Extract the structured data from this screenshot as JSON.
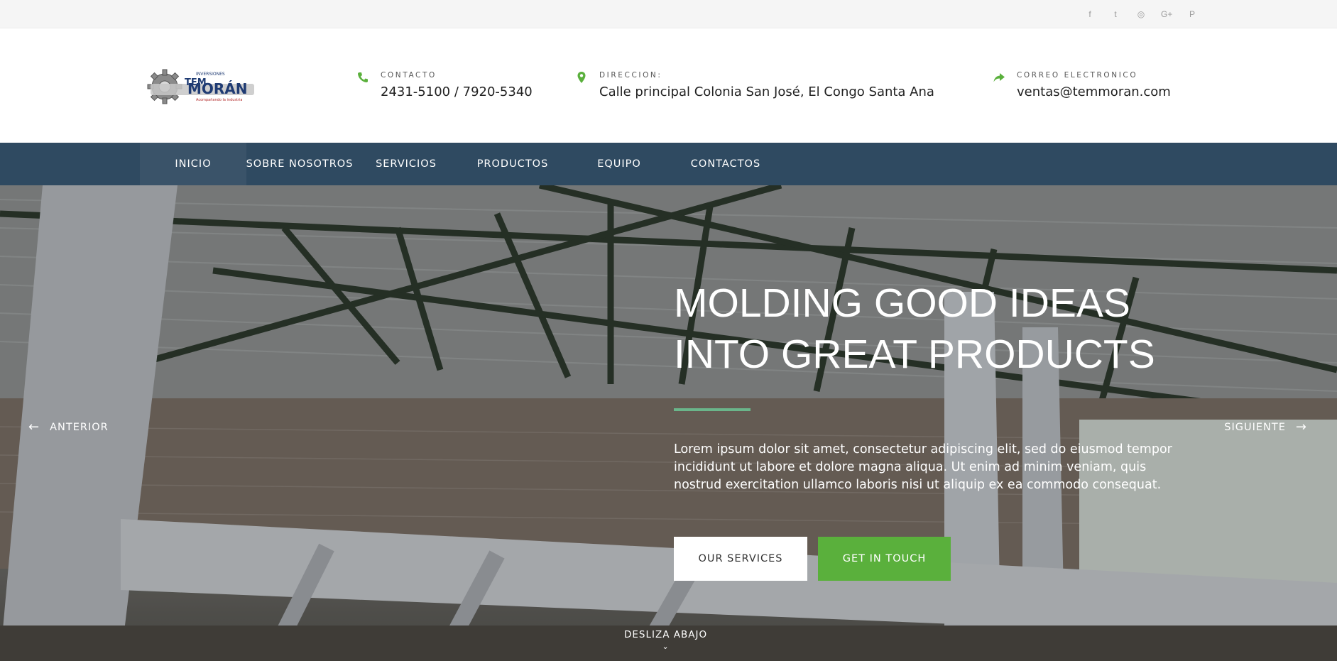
{
  "social": {
    "facebook": "f",
    "twitter": "t",
    "instagram": "◎",
    "google_plus": "G+",
    "pinterest": "P"
  },
  "header": {
    "logo": {
      "line1": "INVERSIONES",
      "line2": "TEM",
      "line3": "MORÁN",
      "tagline": "Acompañando la industria"
    },
    "contact": {
      "label": "CONTACTO",
      "value": "2431-5100 / 7920-5340",
      "icon": "phone-icon"
    },
    "address": {
      "label": "DIRECCION:",
      "value": "Calle principal Colonia San José, El Congo Santa Ana",
      "icon": "map-pin-icon"
    },
    "email": {
      "label": "CORREO ELECTRONICO",
      "value": "ventas@temmoran.com",
      "icon": "share-arrow-icon"
    },
    "accent_color": "#5ab03c"
  },
  "nav": {
    "items": [
      {
        "label": "INICIO",
        "active": true
      },
      {
        "label": "SOBRE NOSOTROS",
        "active": false
      },
      {
        "label": "SERVICIOS",
        "active": false
      },
      {
        "label": "PRODUCTOS",
        "active": false
      },
      {
        "label": "EQUIPO",
        "active": false
      },
      {
        "label": "CONTACTOS",
        "active": false
      }
    ],
    "background": "#2f4a61"
  },
  "hero": {
    "title_line1": "MOLDING GOOD IDEAS",
    "title_line2": "INTO GREAT PRODUCTS",
    "text": "Lorem ipsum dolor sit amet, consectetur adipiscing elit, sed do eiusmod tempor incididunt ut labore et dolore magna aliqua. Ut enim ad minim veniam, quis nostrud exercitation ullamco laboris nisi ut aliquip ex ea commodo consequat.",
    "btn_services": "OUR SERVICES",
    "btn_touch": "GET IN TOUCH",
    "prev": "ANTERIOR",
    "next": "SIGUIENTE",
    "scroll": "DESLIZA ABAJO"
  }
}
